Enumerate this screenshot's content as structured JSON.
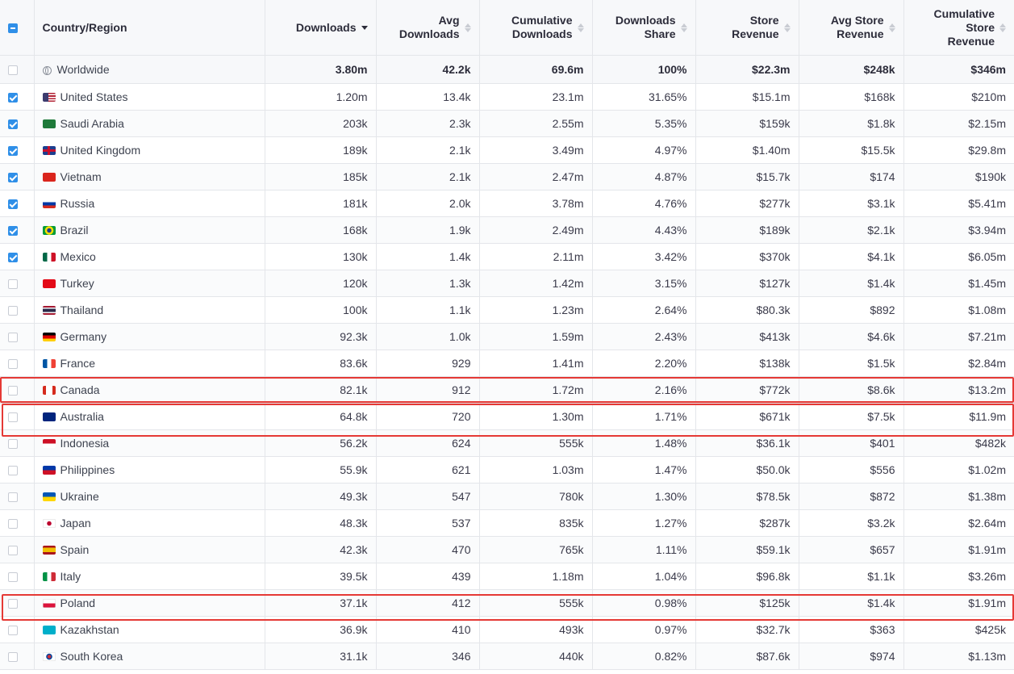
{
  "columns": [
    {
      "id": "country",
      "label": "Country/Region",
      "sortable": false
    },
    {
      "id": "downloads",
      "label": "Downloads",
      "sortable": true,
      "active": true
    },
    {
      "id": "avg_downloads",
      "label": "Avg\nDownloads",
      "sortable": true
    },
    {
      "id": "cum_downloads",
      "label": "Cumulative\nDownloads",
      "sortable": true
    },
    {
      "id": "share",
      "label": "Downloads\nShare",
      "sortable": true
    },
    {
      "id": "revenue",
      "label": "Store\nRevenue",
      "sortable": true
    },
    {
      "id": "avg_revenue",
      "label": "Avg Store\nRevenue",
      "sortable": true
    },
    {
      "id": "cum_revenue",
      "label": "Cumulative\nStore\nRevenue",
      "sortable": true
    }
  ],
  "rows": [
    {
      "name": "Worldwide",
      "flag": "globe",
      "checked": false,
      "v": [
        "3.80m",
        "42.2k",
        "69.6m",
        "100%",
        "$22.3m",
        "$248k",
        "$346m"
      ],
      "worldwide": true
    },
    {
      "name": "United States",
      "flag": "us",
      "checked": true,
      "v": [
        "1.20m",
        "13.4k",
        "23.1m",
        "31.65%",
        "$15.1m",
        "$168k",
        "$210m"
      ]
    },
    {
      "name": "Saudi Arabia",
      "flag": "sa",
      "checked": true,
      "v": [
        "203k",
        "2.3k",
        "2.55m",
        "5.35%",
        "$159k",
        "$1.8k",
        "$2.15m"
      ]
    },
    {
      "name": "United Kingdom",
      "flag": "gb",
      "checked": true,
      "v": [
        "189k",
        "2.1k",
        "3.49m",
        "4.97%",
        "$1.40m",
        "$15.5k",
        "$29.8m"
      ]
    },
    {
      "name": "Vietnam",
      "flag": "vn",
      "checked": true,
      "v": [
        "185k",
        "2.1k",
        "2.47m",
        "4.87%",
        "$15.7k",
        "$174",
        "$190k"
      ]
    },
    {
      "name": "Russia",
      "flag": "ru",
      "checked": true,
      "v": [
        "181k",
        "2.0k",
        "3.78m",
        "4.76%",
        "$277k",
        "$3.1k",
        "$5.41m"
      ]
    },
    {
      "name": "Brazil",
      "flag": "br",
      "checked": true,
      "v": [
        "168k",
        "1.9k",
        "2.49m",
        "4.43%",
        "$189k",
        "$2.1k",
        "$3.94m"
      ]
    },
    {
      "name": "Mexico",
      "flag": "mx",
      "checked": true,
      "v": [
        "130k",
        "1.4k",
        "2.11m",
        "3.42%",
        "$370k",
        "$4.1k",
        "$6.05m"
      ]
    },
    {
      "name": "Turkey",
      "flag": "tr",
      "checked": false,
      "v": [
        "120k",
        "1.3k",
        "1.42m",
        "3.15%",
        "$127k",
        "$1.4k",
        "$1.45m"
      ]
    },
    {
      "name": "Thailand",
      "flag": "th",
      "checked": false,
      "v": [
        "100k",
        "1.1k",
        "1.23m",
        "2.64%",
        "$80.3k",
        "$892",
        "$1.08m"
      ]
    },
    {
      "name": "Germany",
      "flag": "de",
      "checked": false,
      "v": [
        "92.3k",
        "1.0k",
        "1.59m",
        "2.43%",
        "$413k",
        "$4.6k",
        "$7.21m"
      ]
    },
    {
      "name": "France",
      "flag": "fr",
      "checked": false,
      "v": [
        "83.6k",
        "929",
        "1.41m",
        "2.20%",
        "$138k",
        "$1.5k",
        "$2.84m"
      ]
    },
    {
      "name": "Canada",
      "flag": "ca",
      "checked": false,
      "v": [
        "82.1k",
        "912",
        "1.72m",
        "2.16%",
        "$772k",
        "$8.6k",
        "$13.2m"
      ],
      "highlight": true
    },
    {
      "name": "Australia",
      "flag": "au",
      "checked": false,
      "v": [
        "64.8k",
        "720",
        "1.30m",
        "1.71%",
        "$671k",
        "$7.5k",
        "$11.9m"
      ],
      "highlight": true
    },
    {
      "name": "Indonesia",
      "flag": "id",
      "checked": false,
      "v": [
        "56.2k",
        "624",
        "555k",
        "1.48%",
        "$36.1k",
        "$401",
        "$482k"
      ]
    },
    {
      "name": "Philippines",
      "flag": "ph",
      "checked": false,
      "v": [
        "55.9k",
        "621",
        "1.03m",
        "1.47%",
        "$50.0k",
        "$556",
        "$1.02m"
      ]
    },
    {
      "name": "Ukraine",
      "flag": "ua",
      "checked": false,
      "v": [
        "49.3k",
        "547",
        "780k",
        "1.30%",
        "$78.5k",
        "$872",
        "$1.38m"
      ]
    },
    {
      "name": "Japan",
      "flag": "jp",
      "checked": false,
      "v": [
        "48.3k",
        "537",
        "835k",
        "1.27%",
        "$287k",
        "$3.2k",
        "$2.64m"
      ]
    },
    {
      "name": "Spain",
      "flag": "es",
      "checked": false,
      "v": [
        "42.3k",
        "470",
        "765k",
        "1.11%",
        "$59.1k",
        "$657",
        "$1.91m"
      ]
    },
    {
      "name": "Italy",
      "flag": "it",
      "checked": false,
      "v": [
        "39.5k",
        "439",
        "1.18m",
        "1.04%",
        "$96.8k",
        "$1.1k",
        "$3.26m"
      ]
    },
    {
      "name": "Poland",
      "flag": "pl",
      "checked": false,
      "v": [
        "37.1k",
        "412",
        "555k",
        "0.98%",
        "$125k",
        "$1.4k",
        "$1.91m"
      ],
      "highlight": true
    },
    {
      "name": "Kazakhstan",
      "flag": "kz",
      "checked": false,
      "v": [
        "36.9k",
        "410",
        "493k",
        "0.97%",
        "$32.7k",
        "$363",
        "$425k"
      ]
    },
    {
      "name": "South Korea",
      "flag": "kr",
      "checked": false,
      "v": [
        "31.1k",
        "346",
        "440k",
        "0.82%",
        "$87.6k",
        "$974",
        "$1.13m"
      ]
    }
  ],
  "flag_styles": {
    "us": "linear-gradient(90deg,#3c3b6e 0 45%,transparent 45%),repeating-linear-gradient(#b22234 0 1.6px,#ffffff 1.6px 3.2px)",
    "sa": "#1f7a3a",
    "gb": "linear-gradient(#c8102e,#c8102e) center/100% 3px no-repeat,linear-gradient(#c8102e,#c8102e) center/3px 100% no-repeat,#1d3f8f",
    "vn": "#da251d",
    "ru": "linear-gradient(#ffffff 0 33%,#0039a6 33% 66%,#d52b1e 66%)",
    "br": "radial-gradient(circle,#1b3f8f 0 2.5px,#fedf00 3px 5px,#009b3a 5.5px)",
    "mx": "linear-gradient(90deg,#006847 0 33%,#ffffff 33% 66%,#ce1126 66%)",
    "tr": "#e30a17",
    "th": "linear-gradient(#a51931 0 17%,#f4f5f8 17% 33%,#2d2a4a 33% 67%,#f4f5f8 67% 83%,#a51931 83%)",
    "de": "linear-gradient(#000000 0 33%,#dd0000 33% 66%,#ffce00 66%)",
    "fr": "linear-gradient(90deg,#0055a4 0 33%,#ffffff 33% 66%,#ef4135 66%)",
    "ca": "linear-gradient(90deg,#d52b1e 0 25%,#ffffff 25% 75%,#d52b1e 75%)",
    "au": "#00247d",
    "id": "linear-gradient(#ce1126 0 50%,#ffffff 50%)",
    "ph": "linear-gradient(#0038a8 0 50%,#ce1126 50%)",
    "ua": "linear-gradient(#0057b7 0 50%,#ffd700 50%)",
    "jp": "radial-gradient(circle,#bc002d 0 2.5px,#ffffff 3px)",
    "es": "linear-gradient(#aa151b 0 25%,#f1bf00 25% 75%,#aa151b 75%)",
    "it": "linear-gradient(90deg,#009246 0 33%,#ffffff 33% 66%,#ce2b37 66%)",
    "pl": "linear-gradient(#ffffff 0 50%,#dc143c 50%)",
    "kz": "#00afca",
    "kr": "radial-gradient(circle,#cd2e3a 0 2px,#0047a0 2.5px 3.5px,#ffffff 4px)"
  }
}
